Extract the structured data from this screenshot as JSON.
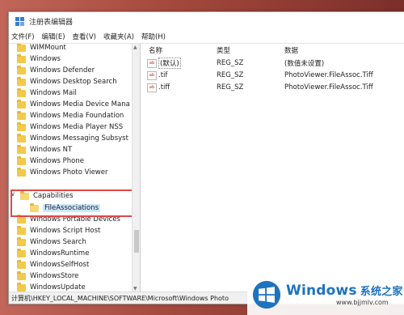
{
  "window": {
    "title": "注册表编辑器"
  },
  "menu": [
    "文件(F)",
    "编辑(E)",
    "查看(V)",
    "收藏夹(A)",
    "帮助(H)"
  ],
  "tree": {
    "items_before": [
      "WIMMount",
      "Windows",
      "Windows Defender",
      "Windows Desktop Search",
      "Windows Mail",
      "Windows Media Device Mana",
      "Windows Media Foundation",
      "Windows Media Player NSS",
      "Windows Messaging Subsyst",
      "Windows NT",
      "Windows Phone",
      "Windows Photo Viewer"
    ],
    "capabilities": "Capabilities",
    "file_associations": "FileAssociations",
    "items_after": [
      "Windows Portable Devices",
      "Windows Script Host",
      "Windows Search",
      "WindowsRuntime",
      "WindowsSelfHost",
      "WindowsStore",
      "WindowsUpdate"
    ]
  },
  "list": {
    "headers": {
      "name": "名称",
      "type": "类型",
      "data": "数据"
    },
    "rows": [
      {
        "icon": "ab",
        "name": "(默认)",
        "type": "REG_SZ",
        "data": "(数值未设置)"
      },
      {
        "icon": "ab",
        "name": ".tif",
        "type": "REG_SZ",
        "data": "PhotoViewer.FileAssoc.Tiff"
      },
      {
        "icon": "ab",
        "name": ".tiff",
        "type": "REG_SZ",
        "data": "PhotoViewer.FileAssoc.Tiff"
      }
    ]
  },
  "statusbar": {
    "path": "计算机\\HKEY_LOCAL_MACHINE\\SOFTWARE\\Microsoft\\Windows Photo"
  },
  "watermark": {
    "brand": "Windows",
    "sub": "系统之家",
    "url": "www.bjjmlv.com"
  },
  "colors": {
    "accent": "#e04848",
    "folder": "#f2c94c",
    "brand": "#1e73be"
  }
}
